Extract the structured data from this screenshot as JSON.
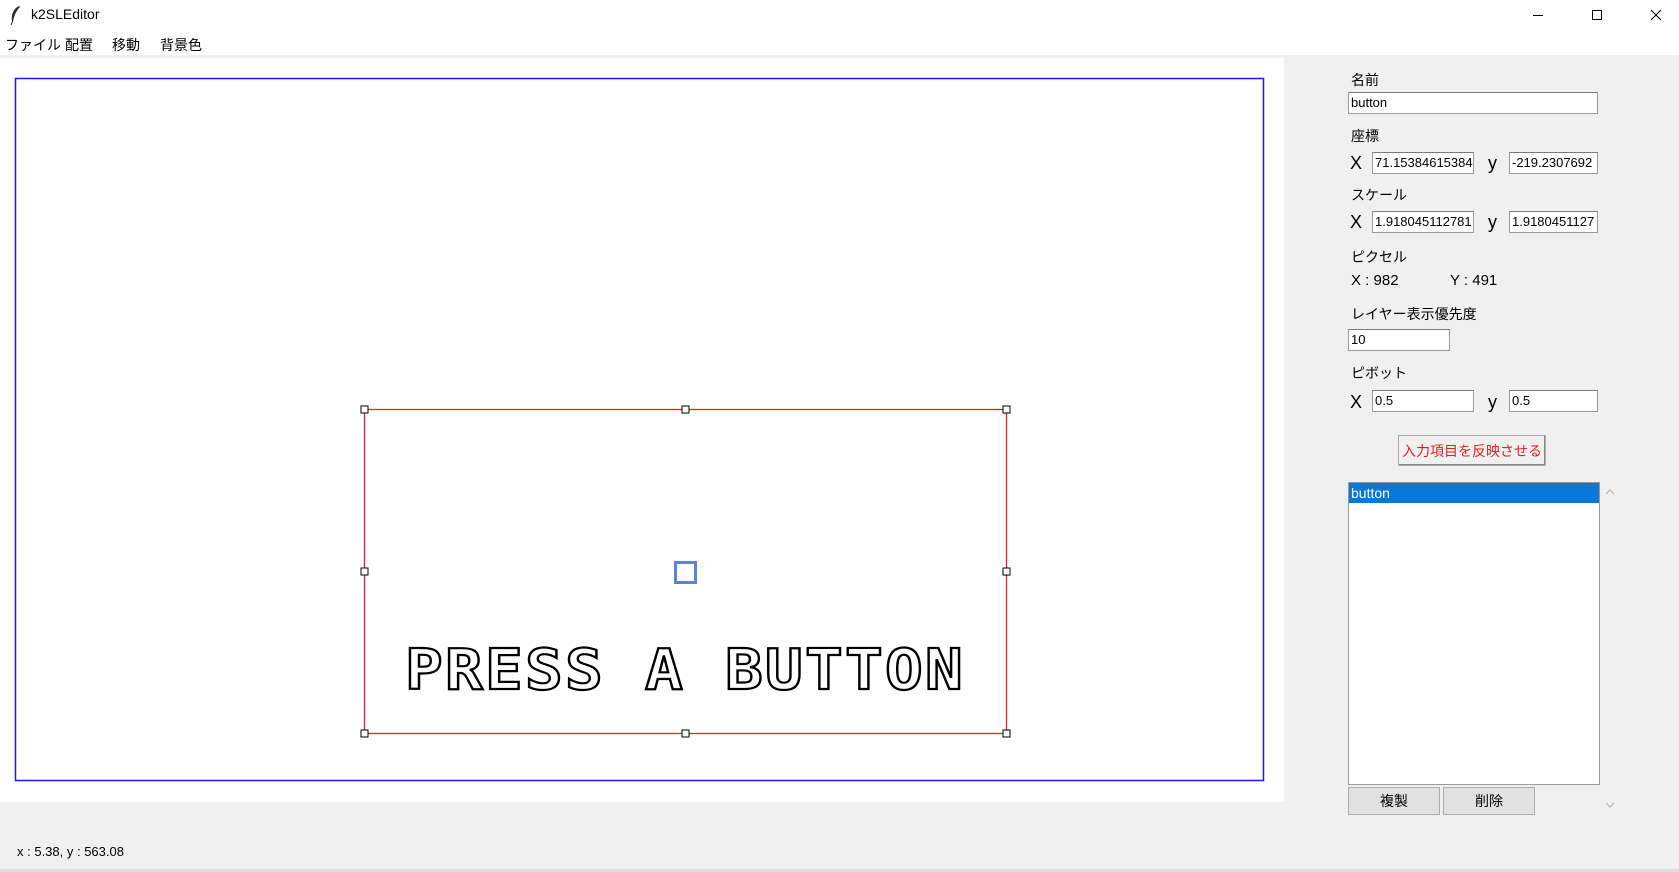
{
  "window": {
    "title": "k2SLEditor",
    "minimize_glyph": "—",
    "maximize_glyph": "☐",
    "close_glyph": "✕"
  },
  "menu": [
    "ファイル",
    "配置",
    "移動",
    "背景色"
  ],
  "canvas": {
    "selected_text": "PRESS A BUTTON",
    "frame_color": "#1a1aff",
    "selection_color": "#e0232b",
    "pivot_color": "#5b84d8"
  },
  "status": "x : 5.38, y : 563.08",
  "properties": {
    "name_label": "名前",
    "name_value": "button",
    "position_label": "座標",
    "pos_x_label": "X",
    "pos_x": "71.15384615384",
    "pos_y_label": "y",
    "pos_y": "-219.2307692",
    "scale_label": "スケール",
    "scale_x_label": "X",
    "scale_x": "1.918045112781",
    "scale_y_label": "y",
    "scale_y": "1.9180451127",
    "pixel_label": "ピクセル",
    "pixel_x": "X : 982",
    "pixel_y": "Y : 491",
    "layer_label": "レイヤー表示優先度",
    "layer_value": "10",
    "pivot_label": "ピボット",
    "pivot_x_label": "X",
    "pivot_x": "0.5",
    "pivot_y_label": "y",
    "pivot_y": "0.5",
    "apply_label": "入力項目を反映させる"
  },
  "objects": {
    "items": [
      "button"
    ],
    "selected_index": 0,
    "duplicate_label": "複製",
    "delete_label": "削除"
  }
}
